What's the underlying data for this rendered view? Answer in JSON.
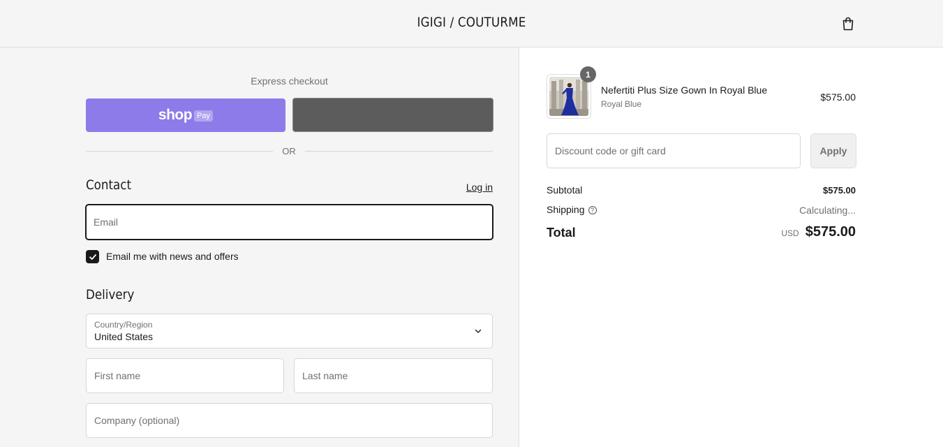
{
  "header": {
    "brand": "IGIGI / COUTURME",
    "cart_icon": "shopping-bag-icon"
  },
  "express": {
    "title": "Express checkout",
    "shop_pay": {
      "word": "shop",
      "tag": "Pay",
      "color": "#8d7be9"
    },
    "or": "OR"
  },
  "contact": {
    "title": "Contact",
    "login": "Log in",
    "email_placeholder": "Email",
    "newsletter_label": "Email me with news and offers",
    "newsletter_checked": true
  },
  "delivery": {
    "title": "Delivery",
    "country_label": "Country/Region",
    "country_value": "United States",
    "first_name_placeholder": "First name",
    "last_name_placeholder": "Last name",
    "company_placeholder": "Company (optional)"
  },
  "order": {
    "item": {
      "quantity": "1",
      "name": "Nefertiti Plus Size Gown In Royal Blue",
      "variant": "Royal Blue",
      "price": "$575.00"
    },
    "discount_placeholder": "Discount code or gift card",
    "apply_label": "Apply",
    "subtotal_label": "Subtotal",
    "subtotal_value": "$575.00",
    "shipping_label": "Shipping",
    "shipping_value": "Calculating...",
    "total_label": "Total",
    "currency": "USD",
    "total_value": "$575.00"
  }
}
